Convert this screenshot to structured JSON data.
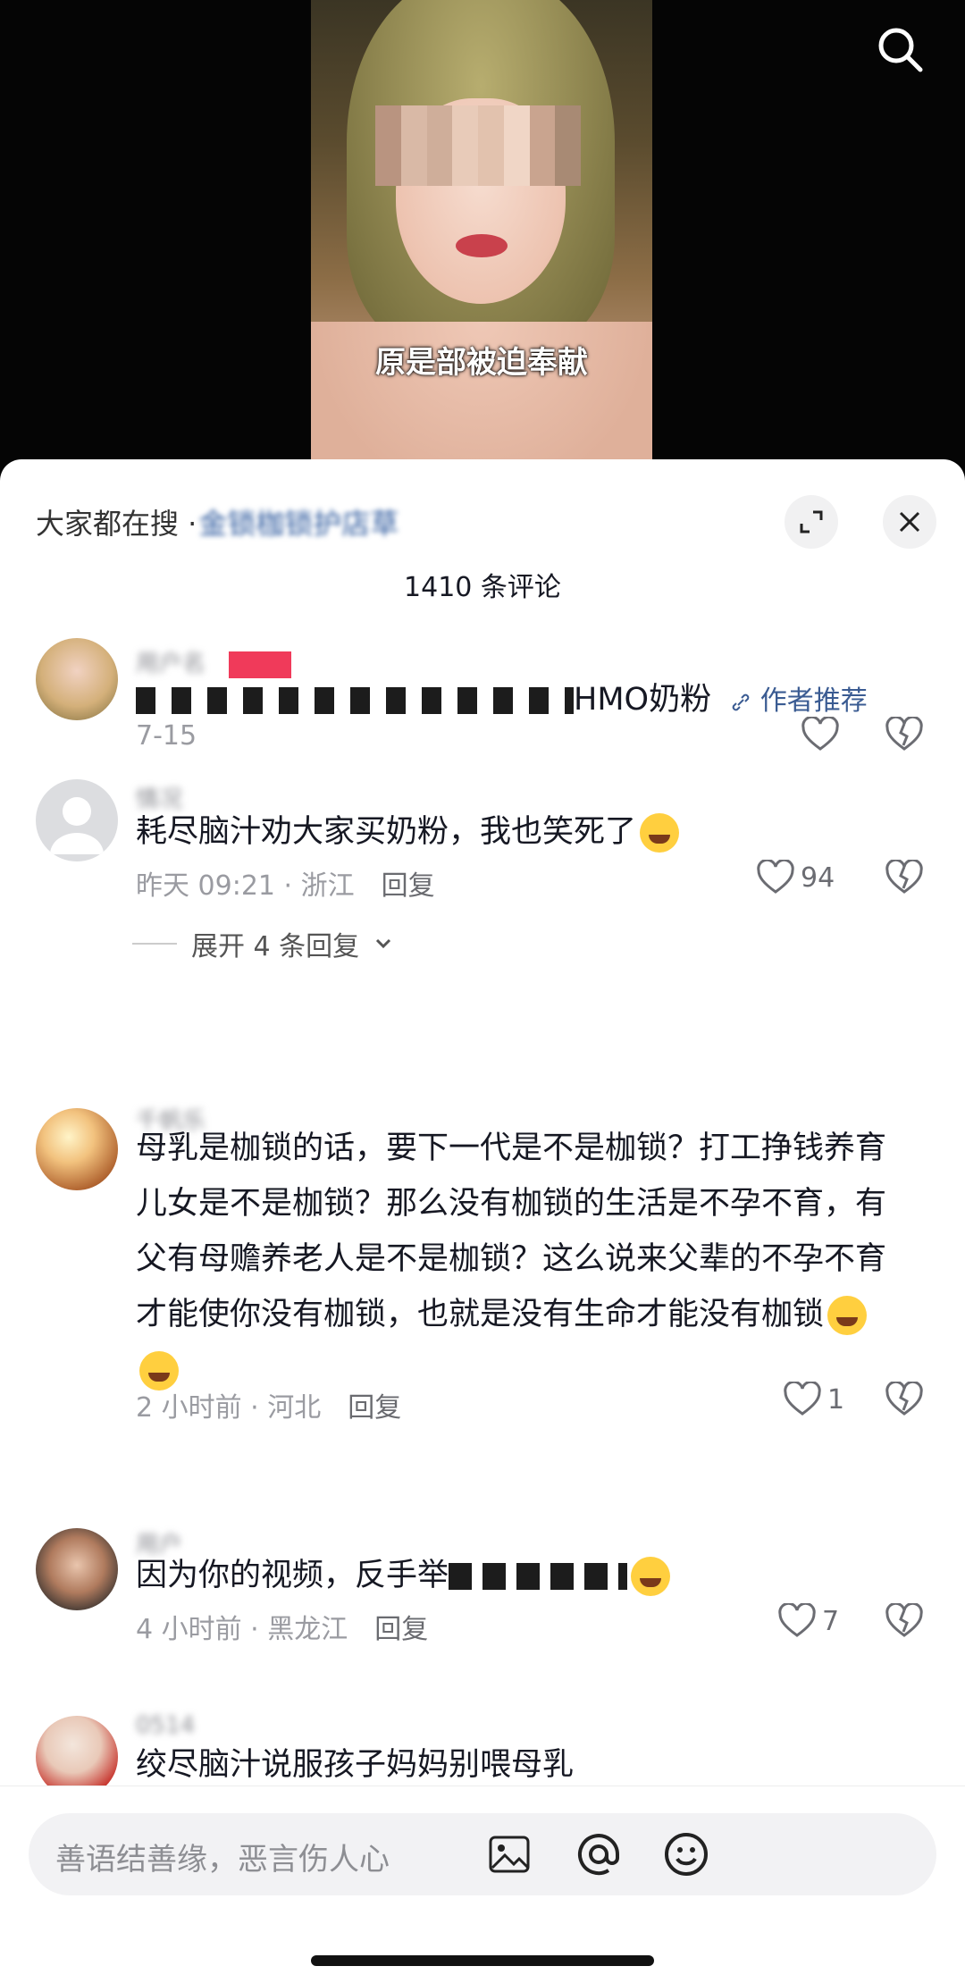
{
  "video": {
    "caption": "原是部被迫奉献"
  },
  "sheet": {
    "search_hint_prefix": "大家都在搜 · ",
    "search_hint_term": "金锁枷锁护店草",
    "comment_count": "1410 条评论"
  },
  "comments": [
    {
      "name": "用户名",
      "text_suffix": "HMO奶粉",
      "author_tag": "作者推荐",
      "time": "7-15",
      "likes": ""
    },
    {
      "name": "情况",
      "text": "耗尽脑汁劝大家买奶粉，我也笑死了",
      "time": "昨天 09:21 · 浙江",
      "reply": "回复",
      "likes": "94",
      "expand": "展开 4 条回复"
    },
    {
      "name": "千帆乐",
      "text": "母乳是枷锁的话，要下一代是不是枷锁？打工挣钱养育儿女是不是枷锁？那么没有枷锁的生活是不孕不育，有父有母赡养老人是不是枷锁？这么说来父辈的不孕不育才能使你没有枷锁，也就是没有生命才能没有枷锁",
      "time": "2 小时前 · 河北",
      "reply": "回复",
      "likes": "1"
    },
    {
      "name": "用户",
      "text_prefix": "因为你的视频，反手举",
      "time": "4 小时前 · 黑龙江",
      "reply": "回复",
      "likes": "7"
    },
    {
      "name": "0514",
      "text": "绞尽脑汁说服孩子妈妈别喂母乳"
    }
  ],
  "input": {
    "placeholder": "善语结善缘，恶言伤人心"
  },
  "colors": {
    "link_blue": "#3a5b92",
    "text_main": "#161823",
    "meta_gray": "#9a9ba1"
  }
}
